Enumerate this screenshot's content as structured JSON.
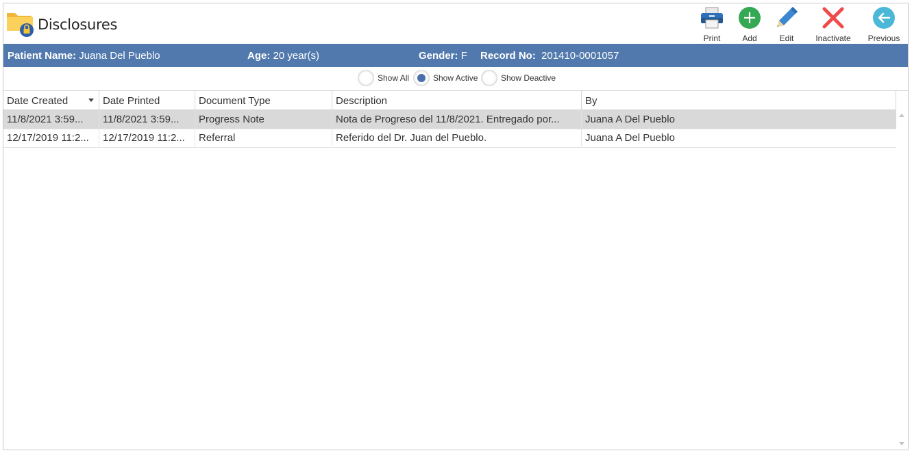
{
  "header": {
    "title": "Disclosures",
    "toolbar": [
      {
        "label": "Print",
        "icon": "printer-icon"
      },
      {
        "label": "Add",
        "icon": "plus-circle-icon"
      },
      {
        "label": "Edit",
        "icon": "pencil-icon"
      },
      {
        "label": "Inactivate",
        "icon": "x-mark-icon"
      },
      {
        "label": "Previous",
        "icon": "arrow-left-circle-icon"
      }
    ]
  },
  "patient": {
    "name_label": "Patient Name:",
    "name": "Juana Del Pueblo",
    "age_label": "Age:",
    "age": "20 year(s)",
    "gender_label": "Gender:",
    "gender": "F",
    "record_label": "Record No:",
    "record": "201410-0001057"
  },
  "filter": {
    "options": [
      "Show All",
      "Show Active",
      "Show Deactive"
    ],
    "selected": "Show Active"
  },
  "table": {
    "columns": [
      "Date Created",
      "Date Printed",
      "Document Type",
      "Description",
      "By"
    ],
    "rows": [
      [
        "11/8/2021 3:59...",
        "11/8/2021 3:59...",
        "Progress Note",
        "Nota de Progreso del 11/8/2021. Entregado por...",
        "Juana A Del Pueblo"
      ],
      [
        "12/17/2019 11:2...",
        "12/17/2019 11:2...",
        "Referral",
        "Referido del Dr. Juan del Pueblo.",
        "Juana A Del Pueblo"
      ]
    ],
    "selected_row": 0
  },
  "colors": {
    "patient_bar": "#5179ad",
    "selected_row": "#d9d9d9",
    "radio_selected": "#4a6fad"
  }
}
